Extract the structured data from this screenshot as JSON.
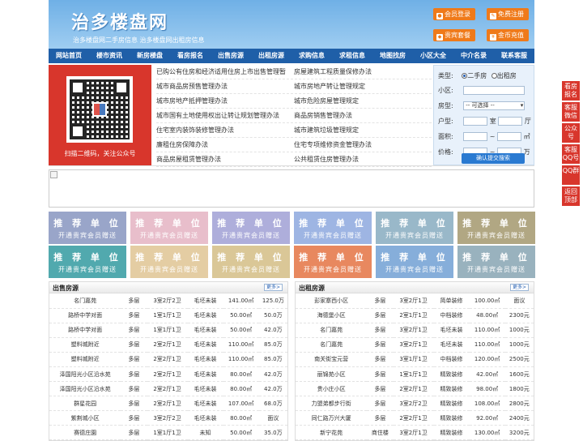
{
  "header": {
    "logo": "治多楼盘网",
    "subtitle": "治多楼盘网二手房信息    治多楼盘网出租房信息",
    "buttons": [
      {
        "label": "会员登录"
      },
      {
        "label": "免费注册"
      },
      {
        "label": "贵宾套餐"
      },
      {
        "label": "金币充值"
      }
    ]
  },
  "nav": [
    "网站首页",
    "楼市资讯",
    "新房楼盘",
    "看房报名",
    "出售房源",
    "出租房源",
    "求购信息",
    "求租信息",
    "地图找房",
    "小区大全",
    "中介名录",
    "联系客服"
  ],
  "qr": {
    "caption": "扫描二维码，关注公众号"
  },
  "links": [
    [
      "已购公有住房和经济适用住房上市出售管理暂",
      "房屋建筑工程质量保修办法"
    ],
    [
      "城市商品房预售管理办法",
      "城市房地产转让管理规定"
    ],
    [
      "城市房地产抵押管理办法",
      "城市危险房屋管理规定"
    ],
    [
      "城市国有土地使用权出让转让规划管理办法",
      "商品房销售管理办法"
    ],
    [
      "住宅室内装饰装修管理办法",
      "城市建筑垃圾管理规定"
    ],
    [
      "廉租住房保障办法",
      "住宅专项维修资金管理办法"
    ],
    [
      "商品房屋租赁管理办法",
      "公共租赁住房管理办法"
    ]
  ],
  "search": {
    "type_label": "类型:",
    "type_options": [
      "二手房",
      "出租房"
    ],
    "community_label": "小区:",
    "house_type_label": "房型:",
    "house_type_value": "-- 可选择 --",
    "layout_label": "户型:",
    "room_unit": "室",
    "hall_unit": "厅",
    "area_label": "面积:",
    "area_sep": "~",
    "area_unit": "㎡",
    "price_label": "价格:",
    "price_sep": "~",
    "price_unit": "万",
    "submit": "确认提交搜索"
  },
  "ads": {
    "line1": "推 荐 单 位",
    "line2": "开通贵宾会员赠送",
    "colors": [
      "#8e9cc4",
      "#e6b8c6",
      "#a6a6d8",
      "#94aee0",
      "#8fb1c4",
      "#a99e76",
      "#3fa0a6",
      "#e2c89a",
      "#d6c28c",
      "#e67c4e",
      "#7aa6d6",
      "#8faab8"
    ]
  },
  "sale": {
    "title": "出售房源",
    "more": "更多>",
    "rows": [
      [
        "名门嘉苑",
        "多层",
        "3室2厅2卫",
        "毛坯未装",
        "141.00㎡",
        "125.0万"
      ],
      [
        "路桥中学对面",
        "多层",
        "1室1厅1卫",
        "毛坯未装",
        "50.00㎡",
        "50.0万"
      ],
      [
        "路桥中学对面",
        "多层",
        "1室1厅1卫",
        "毛坯未装",
        "50.00㎡",
        "42.0万"
      ],
      [
        "塑料城附近",
        "多层",
        "2室2厅1卫",
        "毛坯未装",
        "110.00㎡",
        "85.0万"
      ],
      [
        "塑料城附近",
        "多层",
        "2室2厅1卫",
        "毛坯未装",
        "110.00㎡",
        "85.0万"
      ],
      [
        "泽国阳光小区沿水苑",
        "多层",
        "2室2厅1卫",
        "毛坯未装",
        "80.00㎡",
        "42.0万"
      ],
      [
        "泽国阳光小区沿水苑",
        "多层",
        "2室2厅1卫",
        "毛坯未装",
        "80.00㎡",
        "42.0万"
      ],
      [
        "群星花园",
        "多层",
        "2室2厅1卫",
        "毛坯未装",
        "107.00㎡",
        "68.0万"
      ],
      [
        "紫荆城小区",
        "多层",
        "3室2厅2卫",
        "毛坯未装",
        "80.00㎡",
        "面议"
      ],
      [
        "赛德庄園",
        "多层",
        "1室1厅1卫",
        "未知",
        "50.00㎡",
        "35.0万"
      ]
    ]
  },
  "rent": {
    "title": "出租房源",
    "more": "更多>",
    "rows": [
      [
        "彭家寨西小区",
        "多层",
        "3室2厅1卫",
        "简单装修",
        "100.00㎡",
        "面议"
      ],
      [
        "海德堡小区",
        "多层",
        "2室1厅1卫",
        "中档装修",
        "48.00㎡",
        "2300元"
      ],
      [
        "名门嘉苑",
        "多层",
        "3室2厅1卫",
        "毛坯未装",
        "110.00㎡",
        "1000元"
      ],
      [
        "名门嘉苑",
        "多层",
        "3室2厅1卫",
        "毛坯未装",
        "110.00㎡",
        "1000元"
      ],
      [
        "南关街宝元营",
        "多层",
        "3室1厅1卫",
        "中档装修",
        "120.00㎡",
        "2500元"
      ],
      [
        "丽锦苑小区",
        "多层",
        "1室1厅1卫",
        "精致装修",
        "42.00㎡",
        "1600元"
      ],
      [
        "贵小庄小区",
        "多层",
        "2室2厅1卫",
        "精致装修",
        "98.00㎡",
        "1800元"
      ],
      [
        "力盟弟都步行街",
        "多层",
        "3室2厅2卫",
        "精致装修",
        "108.00㎡",
        "2800元"
      ],
      [
        "同仁路万兴大厦",
        "多层",
        "2室2厅1卫",
        "精致装修",
        "92.00㎡",
        "2400元"
      ],
      [
        "新宁花苑",
        "商住楼",
        "3室2厅1卫",
        "精致装修",
        "130.00㎡",
        "3200元"
      ]
    ]
  },
  "float_buttons": [
    "看房报名",
    "客服微信",
    "公众号",
    "客服QQ号",
    "QQ群",
    "返回顶部"
  ]
}
